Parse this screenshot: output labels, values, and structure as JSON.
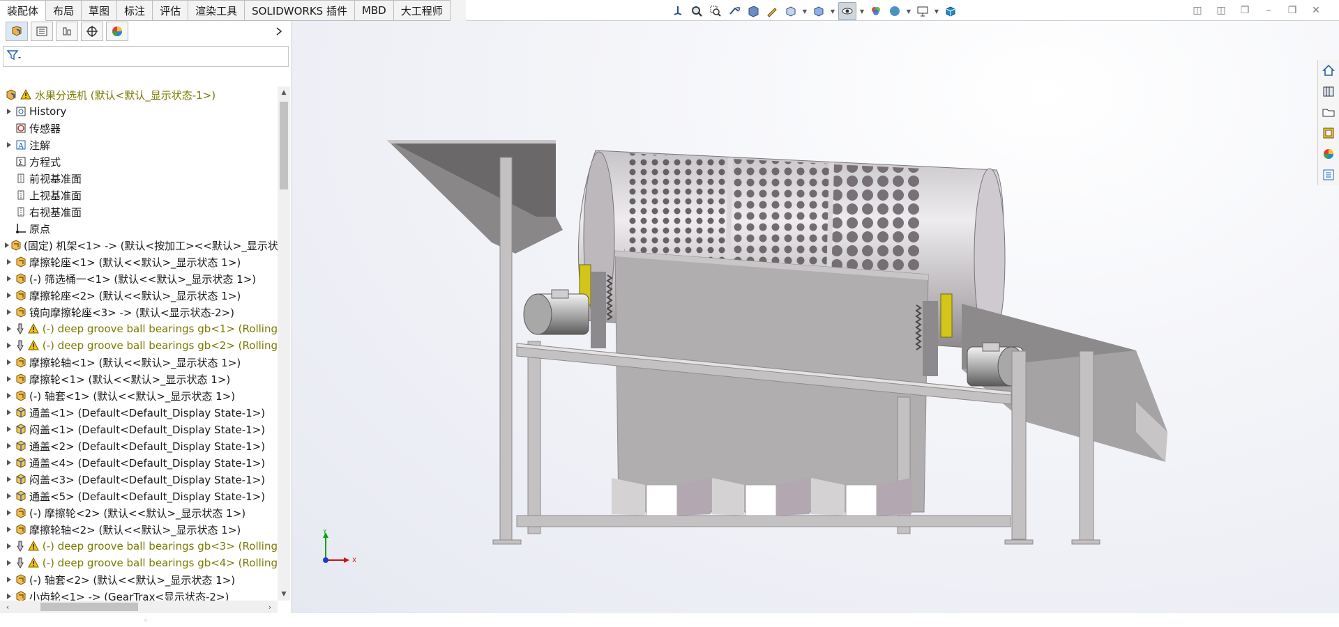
{
  "command_tabs": [
    {
      "label": "装配体",
      "active": true
    },
    {
      "label": "布局"
    },
    {
      "label": "草图"
    },
    {
      "label": "标注"
    },
    {
      "label": "评估"
    },
    {
      "label": "渲染工具"
    },
    {
      "label": "SOLIDWORKS 插件"
    },
    {
      "label": "MBD"
    },
    {
      "label": "大工程师"
    }
  ],
  "tree": {
    "root": {
      "label": "水果分选机  (默认<默认_显示状态-1>)",
      "icon": "assembly-icon",
      "warning": true
    },
    "items": [
      {
        "label": "History",
        "icon": "history-icon",
        "expandable": true
      },
      {
        "label": "传感器",
        "icon": "sensor-icon",
        "expandable": false
      },
      {
        "label": "注解",
        "icon": "annotation-icon",
        "expandable": true
      },
      {
        "label": "方程式",
        "icon": "equation-icon",
        "expandable": false
      },
      {
        "label": "前视基准面",
        "icon": "plane-icon",
        "expandable": false
      },
      {
        "label": "上视基准面",
        "icon": "plane-icon",
        "expandable": false
      },
      {
        "label": "右视基准面",
        "icon": "plane-icon",
        "expandable": false
      },
      {
        "label": "原点",
        "icon": "origin-icon",
        "expandable": false
      },
      {
        "label": "(固定) 机架<1> -> (默认<按加工><<默认>_显示状",
        "icon": "subassembly-icon",
        "expandable": true
      },
      {
        "label": "摩擦轮座<1> (默认<<默认>_显示状态 1>)",
        "icon": "subassembly-icon",
        "expandable": true
      },
      {
        "label": "(-) 筛选桶一<1> (默认<<默认>_显示状态 1>)",
        "icon": "subassembly-icon",
        "expandable": true
      },
      {
        "label": "摩擦轮座<2> (默认<<默认>_显示状态 1>)",
        "icon": "subassembly-icon",
        "expandable": true
      },
      {
        "label": "镜向摩擦轮座<3> -> (默认<显示状态-2>)",
        "icon": "subassembly-icon",
        "expandable": true
      },
      {
        "label": "(-) deep groove ball bearings gb<1> (Rolling",
        "icon": "toolbox-icon",
        "expandable": true,
        "warning": true
      },
      {
        "label": "(-) deep groove ball bearings gb<2> (Rolling",
        "icon": "toolbox-icon",
        "expandable": true,
        "warning": true
      },
      {
        "label": "摩擦轮轴<1> (默认<<默认>_显示状态 1>)",
        "icon": "subassembly-icon",
        "expandable": true
      },
      {
        "label": "摩擦轮<1> (默认<<默认>_显示状态 1>)",
        "icon": "subassembly-icon",
        "expandable": true
      },
      {
        "label": "(-) 轴套<1> (默认<<默认>_显示状态 1>)",
        "icon": "subassembly-icon",
        "expandable": true
      },
      {
        "label": "通盖<1> (Default<Default_Display State-1>)",
        "icon": "part-icon",
        "expandable": true
      },
      {
        "label": "闷盖<1> (Default<Default_Display State-1>)",
        "icon": "part-icon",
        "expandable": true
      },
      {
        "label": "通盖<2> (Default<Default_Display State-1>)",
        "icon": "part-icon",
        "expandable": true
      },
      {
        "label": "通盖<4> (Default<Default_Display State-1>)",
        "icon": "part-icon",
        "expandable": true
      },
      {
        "label": "闷盖<3> (Default<Default_Display State-1>)",
        "icon": "part-icon",
        "expandable": true
      },
      {
        "label": "通盖<5> (Default<Default_Display State-1>)",
        "icon": "part-icon",
        "expandable": true
      },
      {
        "label": "(-) 摩擦轮<2> (默认<<默认>_显示状态 1>)",
        "icon": "subassembly-icon",
        "expandable": true
      },
      {
        "label": "摩擦轮轴<2> (默认<<默认>_显示状态 1>)",
        "icon": "subassembly-icon",
        "expandable": true
      },
      {
        "label": "(-) deep groove ball bearings gb<3> (Rolling",
        "icon": "toolbox-icon",
        "expandable": true,
        "warning": true
      },
      {
        "label": "(-) deep groove ball bearings gb<4> (Rolling",
        "icon": "toolbox-icon",
        "expandable": true,
        "warning": true
      },
      {
        "label": "(-) 轴套<2> (默认<<默认>_显示状态 1>)",
        "icon": "subassembly-icon",
        "expandable": true
      },
      {
        "label": "小齿轮<1> -> (GearTrax<显示状态-2>)",
        "icon": "subassembly-icon",
        "expandable": true
      }
    ]
  },
  "triad": {
    "x": "X",
    "y": "Y"
  },
  "colors": {
    "warning_text": "#7a7a00",
    "accent": "#1f5fae",
    "axis_x": "#d01010",
    "axis_y": "#10a010",
    "axis_z": "#1a3fd0"
  }
}
